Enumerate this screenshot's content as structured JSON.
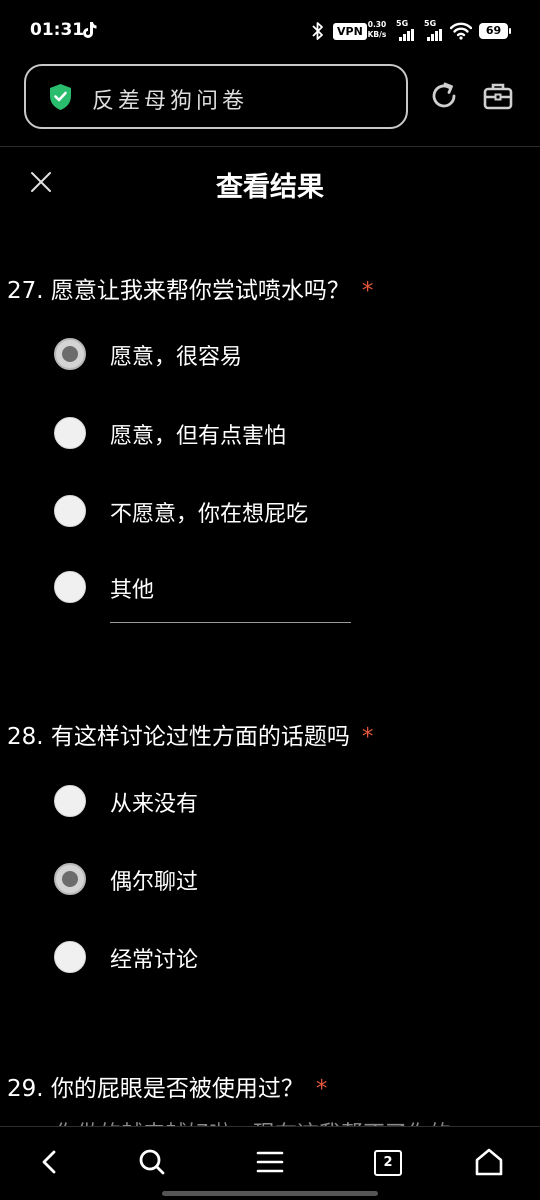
{
  "status_bar": {
    "time": "01:31",
    "vpn": "VPN",
    "net_speed_value": "0.30",
    "net_speed_unit": "KB/s",
    "sim1": "5G",
    "sim2": "5G",
    "battery": "69"
  },
  "browser": {
    "url_text": "反差母狗问卷",
    "tab_count": "2"
  },
  "header": {
    "title": "查看结果"
  },
  "questions": [
    {
      "title": "27. 愿意让我来帮你尝试喷水吗？",
      "required": "*",
      "options": [
        {
          "label": "愿意，很容易",
          "checked": true
        },
        {
          "label": "愿意，但有点害怕",
          "checked": false
        },
        {
          "label": "不愿意，你在想屁吃",
          "checked": false
        },
        {
          "label": "其他",
          "checked": false
        }
      ]
    },
    {
      "title": "28. 有这样讨论过性方面的话题吗",
      "required": "*",
      "options": [
        {
          "label": "从来没有",
          "checked": false
        },
        {
          "label": "偶尔聊过",
          "checked": true
        },
        {
          "label": "经常讨论",
          "checked": false
        }
      ]
    },
    {
      "title": "29. 你的屁眼是否被使用过？",
      "required": "*",
      "options": [
        {
          "label": "你做的越来越好啦，现在这我帮不了你的",
          "checked": false
        }
      ]
    }
  ],
  "colors": {
    "background": "#000000",
    "required_star": "#e2573c",
    "shield": "#2bbd6e"
  }
}
